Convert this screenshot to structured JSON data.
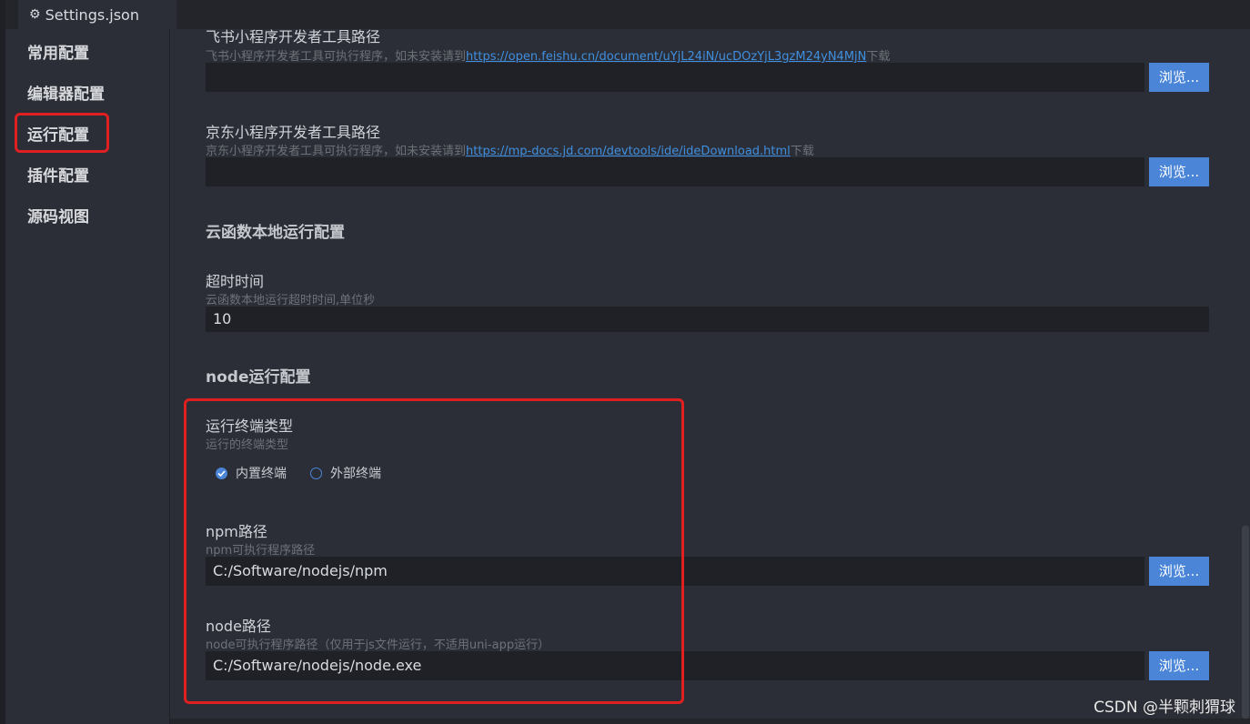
{
  "tab": {
    "label": "Settings.json",
    "icon": "gear-icon"
  },
  "sidebar": {
    "items": [
      {
        "label": "常用配置"
      },
      {
        "label": "编辑器配置"
      },
      {
        "label": "运行配置"
      },
      {
        "label": "插件配置"
      },
      {
        "label": "源码视图"
      }
    ],
    "active_index": 2
  },
  "fields": {
    "feishu": {
      "title": "飞书小程序开发者工具路径",
      "desc_prefix": "飞书小程序开发者工具可执行程序，如未安装请到",
      "link": "https://open.feishu.cn/document/uYjL24iN/ucDOzYjL3gzM24yN4MjN",
      "desc_suffix": "下载",
      "value": "",
      "browse": "浏览..."
    },
    "jd": {
      "title": "京东小程序开发者工具路径",
      "desc_prefix": "京东小程序开发者工具可执行程序，如未安装请到",
      "link": "https://mp-docs.jd.com/devtools/ide/ideDownload.html",
      "desc_suffix": "下载",
      "value": "",
      "browse": "浏览..."
    },
    "cloud_section": "云函数本地运行配置",
    "timeout": {
      "title": "超时时间",
      "desc": "云函数本地运行超时时间,单位秒",
      "value": "10"
    },
    "node_section": "node运行配置",
    "terminal": {
      "title": "运行终端类型",
      "desc": "运行的终端类型",
      "options": [
        "内置终端",
        "外部终端"
      ],
      "selected_index": 0
    },
    "npm": {
      "title": "npm路径",
      "desc": "npm可执行程序路径",
      "value": "C:/Software/nodejs/npm",
      "browse": "浏览..."
    },
    "node": {
      "title": "node路径",
      "desc": "node可执行程序路径（仅用于js文件运行，不适用uni-app运行）",
      "value": "C:/Software/nodejs/node.exe",
      "browse": "浏览..."
    }
  },
  "colors": {
    "accent": "#4a85d8",
    "highlight": "#e02020",
    "background": "#2b2e36",
    "input_bg": "#1f2127",
    "link": "#3f8fe0"
  },
  "watermark": "CSDN @半颗刺猬球"
}
